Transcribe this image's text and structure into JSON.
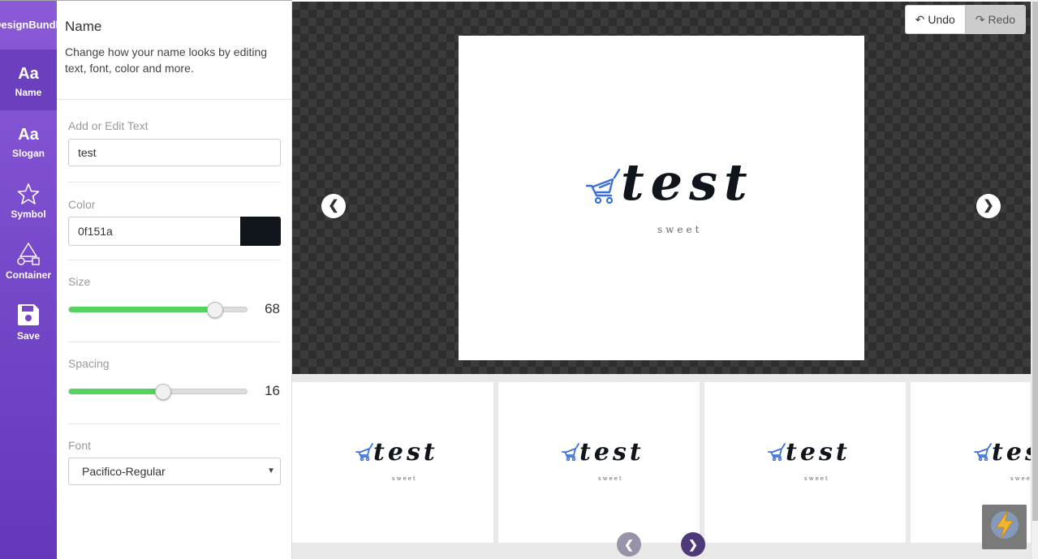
{
  "sidebar": {
    "brand": "DesignBundl",
    "items": [
      {
        "label": "Name",
        "icon": "text-icon",
        "glyph": "Aa"
      },
      {
        "label": "Slogan",
        "icon": "text-icon",
        "glyph": "Aa"
      },
      {
        "label": "Symbol",
        "icon": "star-icon"
      },
      {
        "label": "Container",
        "icon": "shapes-icon"
      },
      {
        "label": "Save",
        "icon": "save-icon"
      }
    ]
  },
  "panel": {
    "title": "Name",
    "description": "Change how your name looks by editing text, font, color and more.",
    "text": {
      "label": "Add or Edit Text",
      "value": "test"
    },
    "color": {
      "label": "Color",
      "value": "0f151a",
      "swatch": "#0f151a"
    },
    "size": {
      "label": "Size",
      "value": "68",
      "fraction": 0.82
    },
    "spacing": {
      "label": "Spacing",
      "value": "16",
      "fraction": 0.53
    },
    "font": {
      "label": "Font",
      "value": "Pacifico-Regular"
    }
  },
  "canvas": {
    "undo_label": "Undo",
    "redo_label": "Redo",
    "prev_arrow": "❮",
    "next_arrow": "❯",
    "logo": {
      "name": "test",
      "slogan": "sweet"
    }
  },
  "thumbnails": [
    {
      "name": "test",
      "slogan": "sweet"
    },
    {
      "name": "test",
      "slogan": "sweet"
    },
    {
      "name": "test",
      "slogan": "sweet"
    },
    {
      "name": "test",
      "slogan": "sweet"
    }
  ],
  "pager": {
    "prev": "❮",
    "next": "❯"
  },
  "colors": {
    "accent": "#7446c8",
    "slider_fill": "#55d35f",
    "cart_icon": "#3a6fd8"
  }
}
